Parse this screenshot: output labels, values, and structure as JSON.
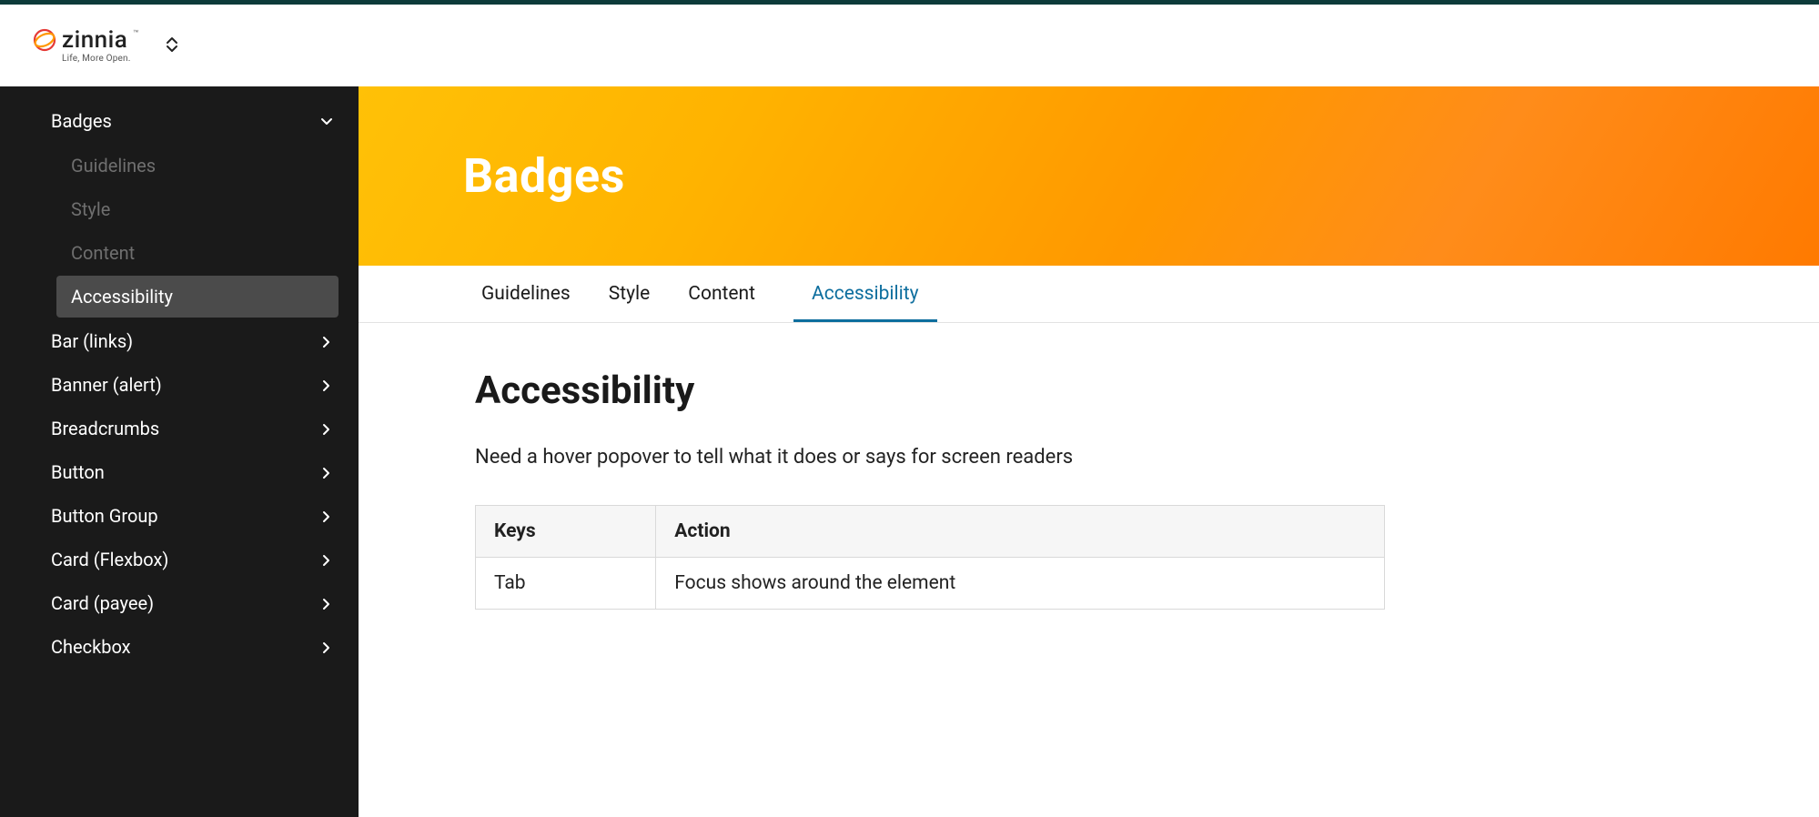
{
  "brand": {
    "name": "zinnia",
    "tagline": "Life, More Open."
  },
  "sidebar": {
    "items": [
      {
        "label": "Badges",
        "expanded": true,
        "children": [
          {
            "label": "Guidelines"
          },
          {
            "label": "Style"
          },
          {
            "label": "Content"
          },
          {
            "label": "Accessibility",
            "active": true
          }
        ]
      },
      {
        "label": "Bar (links)"
      },
      {
        "label": "Banner (alert)"
      },
      {
        "label": "Breadcrumbs"
      },
      {
        "label": "Button"
      },
      {
        "label": "Button Group"
      },
      {
        "label": "Card (Flexbox)"
      },
      {
        "label": "Card (payee)"
      },
      {
        "label": "Checkbox"
      }
    ]
  },
  "hero": {
    "title": "Badges"
  },
  "tabs": [
    {
      "label": "Guidelines"
    },
    {
      "label": "Style"
    },
    {
      "label": "Content"
    },
    {
      "label": "Accessibility",
      "active": true
    }
  ],
  "section": {
    "heading": "Accessibility",
    "description": "Need a hover popover to tell what it does or says for screen readers"
  },
  "table": {
    "headers": [
      "Keys",
      "Action"
    ],
    "rows": [
      [
        "Tab",
        "Focus shows around the element"
      ]
    ]
  }
}
